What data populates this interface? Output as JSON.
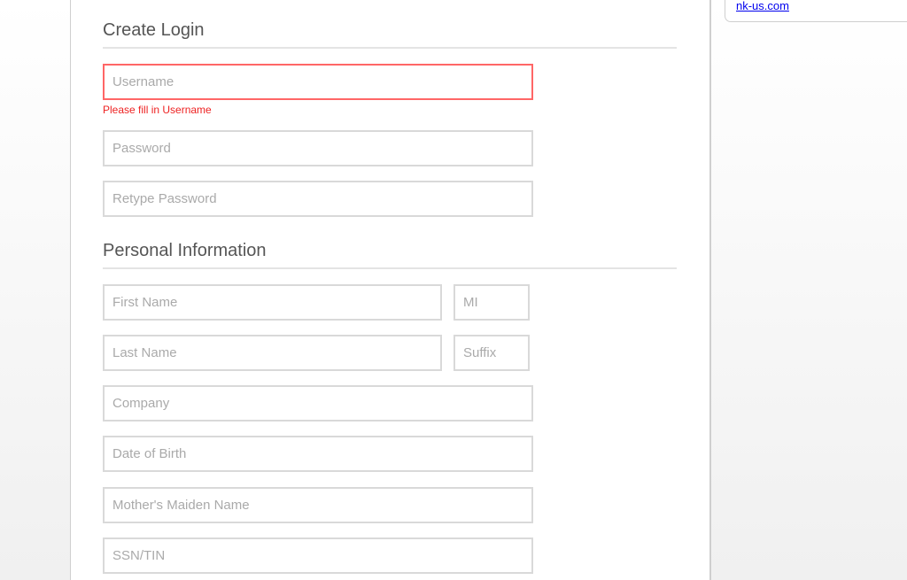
{
  "sidebar": {
    "link": "nk-us.com"
  },
  "create_login": {
    "title": "Create Login",
    "username_placeholder": "Username",
    "username_error": "Please fill in Username",
    "password_placeholder": "Password",
    "retype_placeholder": "Retype Password"
  },
  "personal": {
    "title": "Personal Information",
    "first_name": "First Name",
    "mi": "MI",
    "last_name": "Last Name",
    "suffix": "Suffix",
    "company": "Company",
    "dob": "Date of Birth",
    "maiden": "Mother's Maiden Name",
    "ssn": "SSN/TIN"
  },
  "colors": {
    "error": "#ee2222",
    "link": "#0000ee"
  }
}
